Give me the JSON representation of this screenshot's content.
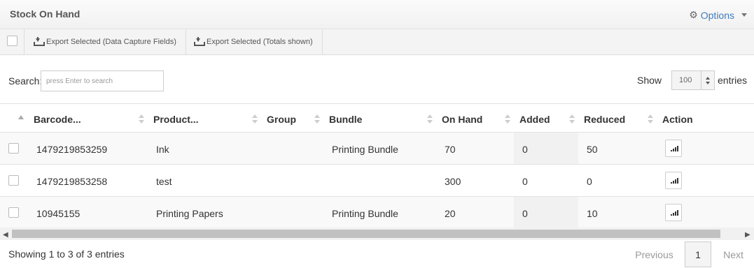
{
  "panel": {
    "title": "Stock On Hand",
    "options_label": "Options"
  },
  "toolbar": {
    "export_data_capture": "Export Selected (Data Capture Fields)",
    "export_totals": "Export Selected (Totals shown)"
  },
  "search": {
    "label": "Search:",
    "placeholder": "press Enter to search"
  },
  "length": {
    "show_label": "Show",
    "value": "100",
    "entries_label": "entries"
  },
  "table": {
    "columns": [
      "Barcode...",
      "Product...",
      "Group",
      "Bundle",
      "On Hand",
      "Added",
      "Reduced",
      "Action"
    ],
    "rows": [
      {
        "barcode": "1479219853259",
        "product": "Ink",
        "group": "",
        "bundle": "Printing Bundle",
        "on_hand": "70",
        "added": "0",
        "reduced": "50"
      },
      {
        "barcode": "1479219853258",
        "product": "test",
        "group": "",
        "bundle": "",
        "on_hand": "300",
        "added": "0",
        "reduced": "0"
      },
      {
        "barcode": "10945155",
        "product": "Printing Papers",
        "group": "",
        "bundle": "Printing Bundle",
        "on_hand": "20",
        "added": "0",
        "reduced": "10"
      }
    ]
  },
  "footer": {
    "info": "Showing 1 to 3 of 3 entries",
    "previous": "Previous",
    "page": "1",
    "next": "Next"
  },
  "icons": {
    "options": "gear-icon",
    "export": "download-icon",
    "action": "bar-chart-icon"
  },
  "colors": {
    "link": "#3d7dbd",
    "header_bg": "#f4f4f4"
  }
}
